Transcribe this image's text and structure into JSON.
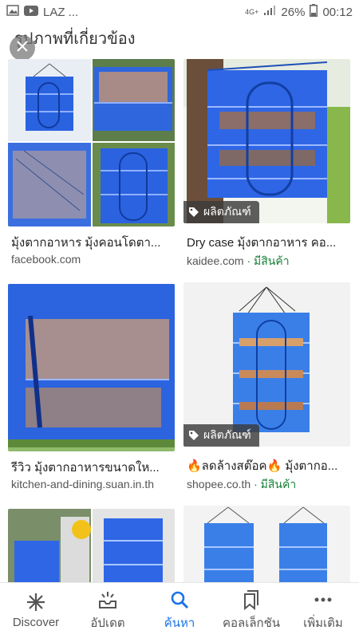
{
  "status": {
    "left_text": "LAZ ...",
    "network": "4G+",
    "battery": "26%",
    "time": "00:12"
  },
  "section": {
    "title": "รูปภาพที่เกี่ยวข้อง"
  },
  "cards": [
    {
      "title": "มุ้งตากอาหาร มุ้งคอนโดตา...",
      "source": "facebook.com",
      "stock": "",
      "badge": ""
    },
    {
      "title": "Dry case มุ้งตากอาหาร คอ...",
      "source": "kaidee.com",
      "stock": "· มีสินค้า",
      "badge": "ผลิตภัณฑ์"
    },
    {
      "title": "รีวิว มุ้งตากอาหารขนาดให...",
      "source": "kitchen-and-dining.suan.in.th",
      "stock": "",
      "badge": ""
    },
    {
      "title": "🔥ลดล้างสต๊อค🔥 มุ้งตากอ...",
      "source": "shopee.co.th",
      "stock": "· มีสินค้า",
      "badge": "ผลิตภัณฑ์"
    }
  ],
  "nav": [
    {
      "label": "Discover",
      "icon": "discover-icon"
    },
    {
      "label": "อัปเดต",
      "icon": "updates-icon"
    },
    {
      "label": "ค้นหา",
      "icon": "search-icon"
    },
    {
      "label": "คอลเล็กชัน",
      "icon": "collections-icon"
    },
    {
      "label": "เพิ่มเติม",
      "icon": "more-icon"
    }
  ],
  "colors": {
    "accent": "#1a73e8",
    "stock_green": "#188038",
    "net_blue": "#2f5fd6"
  }
}
